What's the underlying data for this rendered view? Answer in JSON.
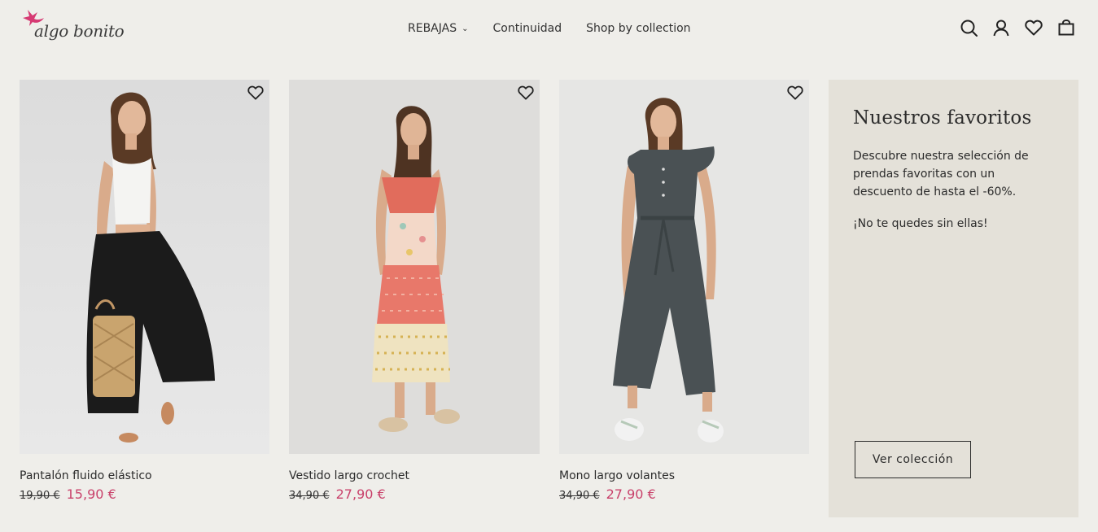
{
  "brand": {
    "name": "algo bonito",
    "accent": "#d63a73"
  },
  "nav": {
    "items": [
      {
        "label": "REBAJAS",
        "has_dropdown": true
      },
      {
        "label": "Continuidad"
      },
      {
        "label": "Shop by collection"
      }
    ]
  },
  "header_icons": [
    "search-icon",
    "account-icon",
    "heart-icon",
    "bag-icon"
  ],
  "products": [
    {
      "name": "Pantalón fluido elástico",
      "old_price": "19,90 €",
      "price": "15,90 €"
    },
    {
      "name": "Vestido largo crochet",
      "old_price": "34,90 €",
      "price": "27,90 €"
    },
    {
      "name": "Mono largo volantes",
      "old_price": "34,90 €",
      "price": "27,90 €"
    }
  ],
  "promo": {
    "title": "Nuestros favoritos",
    "description": "Descubre nuestra selección de prendas favoritas con un descuento de hasta el -60%.",
    "note": "¡No te quedes sin ellas!",
    "button": "Ver colección"
  },
  "colors": {
    "background": "#efeeea",
    "promo_bg": "#e4e1d9",
    "sale_price": "#c9416b"
  }
}
